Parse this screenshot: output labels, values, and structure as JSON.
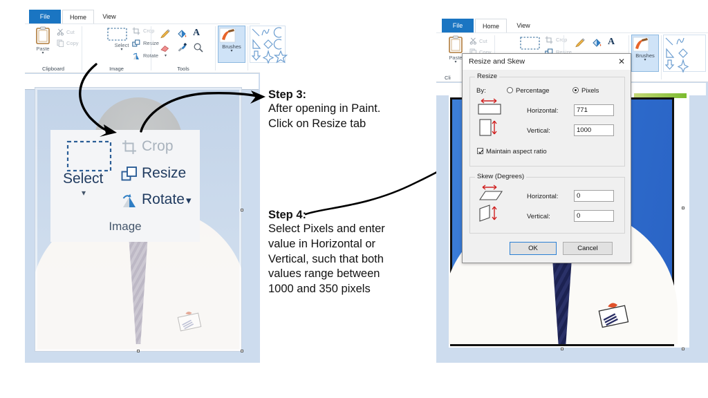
{
  "left_panel": {
    "tabs": [
      {
        "label": "File",
        "state": "file"
      },
      {
        "label": "Home",
        "state": "active"
      },
      {
        "label": "View",
        "state": "normal"
      }
    ],
    "groups": [
      {
        "name": "Clipboard",
        "label": "Clipboard",
        "items": [
          {
            "label": "Paste",
            "icon": "clipboard-icon",
            "enabled": true
          },
          {
            "label": "Cut",
            "icon": "scissors-icon",
            "enabled": false
          },
          {
            "label": "Copy",
            "icon": "copy-icon",
            "enabled": false
          }
        ]
      },
      {
        "name": "Image",
        "label": "Image",
        "items": [
          {
            "label": "Select",
            "icon": "dashed-rect-icon",
            "enabled": true
          },
          {
            "label": "Crop",
            "icon": "crop-icon",
            "enabled": false
          },
          {
            "label": "Resize",
            "icon": "resize-icon",
            "enabled": true
          },
          {
            "label": "Rotate",
            "icon": "rotate-icon",
            "enabled": true
          }
        ]
      },
      {
        "name": "Tools",
        "label": "Tools",
        "items": [
          {
            "label": "Pencil",
            "icon": "pencil-icon"
          },
          {
            "label": "Fill with color",
            "icon": "paint-bucket-icon"
          },
          {
            "label": "Text",
            "icon": "text-a-icon"
          },
          {
            "label": "Eraser",
            "icon": "eraser-icon"
          },
          {
            "label": "Color picker",
            "icon": "color-picker-icon"
          },
          {
            "label": "Magnifier",
            "icon": "magnifier-icon"
          }
        ]
      },
      {
        "name": "Brushes",
        "label": "",
        "items": [
          {
            "label": "Brushes",
            "icon": "brush-icon",
            "selected": true
          }
        ]
      },
      {
        "name": "Shapes",
        "label": "",
        "items": [
          {
            "label": "Line",
            "icon": "line-shape-icon"
          },
          {
            "label": "Curve",
            "icon": "curve-shape-icon"
          },
          {
            "label": "Oval",
            "icon": "oval-shape-icon"
          },
          {
            "label": "Triangle",
            "icon": "triangle-shape-icon"
          },
          {
            "label": "Diamond",
            "icon": "diamond-shape-icon"
          },
          {
            "label": "Arc",
            "icon": "arc-shape-icon"
          },
          {
            "label": "Down arrow",
            "icon": "down-arrow-shape-icon"
          },
          {
            "label": "Four-point star",
            "icon": "star4-shape-icon"
          },
          {
            "label": "Five-point star",
            "icon": "star5-shape-icon"
          }
        ]
      }
    ],
    "canvas": {
      "image_description": "faded portrait photo of a person in a white shirt and tie on a light blue background",
      "faded": true
    }
  },
  "magnified_callout": {
    "select_label": "Select",
    "crop_label": "Crop",
    "resize_label": "Resize",
    "rotate_label": "Rotate",
    "group_label": "Image",
    "crop_enabled": false
  },
  "steps": [
    {
      "id": "step3",
      "title": "Step 3:",
      "lines": [
        "After opening in Paint.",
        "Click on Resize tab"
      ]
    },
    {
      "id": "step4",
      "title": "Step 4:",
      "lines": [
        "Select Pixels and enter",
        "value in Horizontal or",
        "Vertical, such that both",
        "values range between",
        "1000 and 350 pixels"
      ]
    }
  ],
  "right_panel": {
    "tabs": [
      {
        "label": "File",
        "state": "file"
      },
      {
        "label": "Home",
        "state": "active"
      },
      {
        "label": "View",
        "state": "normal"
      }
    ],
    "groups": [
      {
        "name": "Clipboard",
        "label": "Cli",
        "items": [
          {
            "label": "Paste",
            "icon": "clipboard-icon"
          },
          {
            "label": "Cut",
            "icon": "scissors-icon"
          },
          {
            "label": "Copy",
            "icon": "copy-icon"
          }
        ]
      },
      {
        "name": "Image",
        "label": "",
        "items": [
          {
            "label": "Select",
            "icon": "dashed-rect-icon"
          },
          {
            "label": "Crop",
            "icon": "crop-icon"
          },
          {
            "label": "Resize",
            "icon": "resize-icon"
          }
        ]
      },
      {
        "name": "Tools",
        "label": "",
        "items": [
          {
            "label": "Pencil",
            "icon": "pencil-icon"
          },
          {
            "label": "Fill with color",
            "icon": "paint-bucket-icon"
          },
          {
            "label": "Text",
            "icon": "text-a-icon"
          }
        ]
      },
      {
        "name": "Brushes",
        "label": "",
        "items": [
          {
            "label": "Brushes",
            "icon": "brush-icon",
            "selected": true
          }
        ]
      },
      {
        "name": "Shapes",
        "label": "",
        "items": [
          {
            "label": "Line",
            "icon": "line-shape-icon"
          },
          {
            "label": "Curve",
            "icon": "curve-shape-icon"
          },
          {
            "label": "Triangle",
            "icon": "triangle-shape-icon"
          },
          {
            "label": "Diamond",
            "icon": "diamond-shape-icon"
          },
          {
            "label": "Down arrow",
            "icon": "down-arrow-shape-icon"
          },
          {
            "label": "Four-point star",
            "icon": "star4-shape-icon"
          }
        ]
      }
    ],
    "canvas": {
      "image_description": "portrait photo of a person in a white shirt and dark navy tie on a vivid blue background",
      "faded": false
    }
  },
  "dialog": {
    "title": "Resize and Skew",
    "close_label": "✕",
    "resize": {
      "legend": "Resize",
      "by_label": "By:",
      "percentage_label": "Percentage",
      "pixels_label": "Pixels",
      "selected_unit": "Pixels",
      "horizontal_label": "Horizontal:",
      "horizontal_value": "771",
      "vertical_label": "Vertical:",
      "vertical_value": "1000",
      "maintain_label": "Maintain aspect ratio",
      "maintain_checked": true
    },
    "skew": {
      "legend": "Skew (Degrees)",
      "horizontal_label": "Horizontal:",
      "horizontal_value": "0",
      "vertical_label": "Vertical:",
      "vertical_value": "0"
    },
    "buttons": {
      "ok_label": "OK",
      "cancel_label": "Cancel"
    }
  },
  "colors": {
    "tab_file_blue": "#1a75c2",
    "accent_blue": "#2a7fd4",
    "canvas_backdrop": "#cddcee",
    "photo_blue": "#2a6fd4",
    "tie_navy": "#232a5c",
    "green_strip": "#8cc63f",
    "arrow_black": "#000000"
  }
}
